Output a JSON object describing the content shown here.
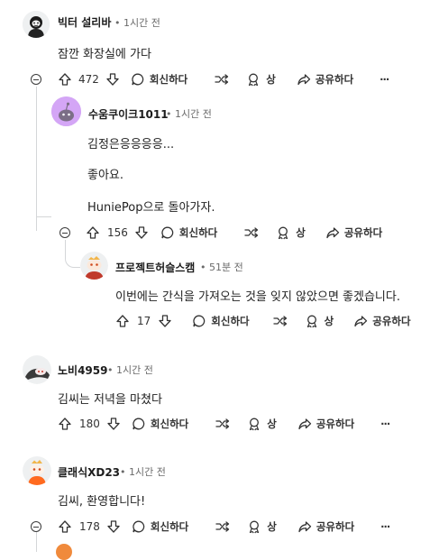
{
  "comments": [
    {
      "author": "빅터 설리바",
      "time": "1시간 전",
      "lines": [
        "잠깐 화장실에 가다"
      ],
      "votes": "472",
      "reply_label": "회신하다",
      "award_label": "상",
      "share_label": "공유하다",
      "avatar_icon": "masked-hacker-avatar-icon"
    },
    {
      "author": "수움쿠이크1011",
      "time": "1시간 전",
      "lines": [
        "김정은응응응응...",
        "좋아요.",
        "HuniePop으로 돌아가자."
      ],
      "votes": "156",
      "reply_label": "회신하다",
      "award_label": "상",
      "share_label": "공유하다",
      "avatar_icon": "purple-snoo-avatar-icon"
    },
    {
      "author": "프로젝트허슬스캠",
      "time": "51분 전",
      "lines": [
        "이번에는 간식을 가져오는 것을 잊지 않았으면 좋겠습니다."
      ],
      "votes": "17",
      "reply_label": "회신하다",
      "award_label": "상",
      "share_label": "공유하다",
      "avatar_icon": "snoo-avatar-icon"
    },
    {
      "author": "노비4959",
      "time": "1시간 전",
      "lines": [
        "김씨는 저녁을 마쳤다"
      ],
      "votes": "180",
      "reply_label": "회신하다",
      "award_label": "상",
      "share_label": "공유하다",
      "avatar_icon": "dark-snoo-avatar-icon"
    },
    {
      "author": "클래식XD23",
      "time": "1시간 전",
      "lines": [
        "김씨, 환영합니다!"
      ],
      "votes": "178",
      "reply_label": "회신하다",
      "award_label": "상",
      "share_label": "공유하다",
      "avatar_icon": "orange-snoo-avatar-icon"
    }
  ],
  "separator": "•",
  "more_label": "···",
  "colors": {
    "thread_line": "#d4d6d8",
    "meta": "#6a6a6a",
    "text": "#1c1c1c"
  }
}
